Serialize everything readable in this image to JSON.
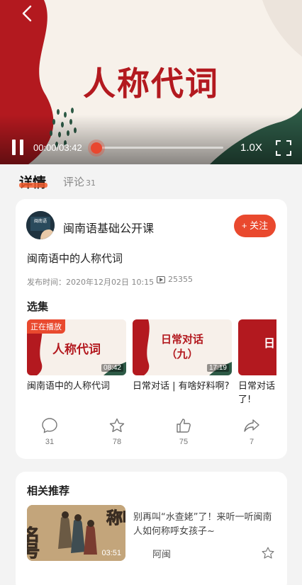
{
  "player": {
    "title": "人称代词",
    "current_time": "00:00",
    "separator": "/",
    "duration": "03:42",
    "speed": "1.0X",
    "progress": 0.0
  },
  "tabs": {
    "detail_label": "详情",
    "comment_label": "评论",
    "comment_count": "31"
  },
  "channel": {
    "avatar_text": "闽南语",
    "name": "闽南语基础公开课",
    "follow_label": "+ 关注"
  },
  "video": {
    "title": "闽南语中的人称代词",
    "publish_time": "发布时间：2020年12月02日 10:15",
    "play_count": "25355"
  },
  "episodes_section": {
    "label": "选集",
    "items": [
      {
        "thumb_text": "人称代词",
        "badge": "正在播放",
        "duration": "08:42",
        "name": "闽南语中的人称代词"
      },
      {
        "thumb_text_1": "日常对话",
        "thumb_text_2": "（九）",
        "duration": "17:19",
        "name": "日常对话 | 有啥好料啊?"
      },
      {
        "thumb_text": "日",
        "name": "日常对话了!"
      }
    ]
  },
  "actions": {
    "comment_count": "31",
    "favorite_count": "78",
    "like_count": "75",
    "share_count": "7"
  },
  "recommend": {
    "label": "相关推荐",
    "thumb_text_left": "名号",
    "thumb_text_right": "称呼",
    "duration": "03:51",
    "title": "别再叫“水查姥”了！来听一听闽南人如何称呼女孩子~",
    "source": "阿闽"
  },
  "colors": {
    "accent": "#e9492e",
    "brand_red": "#b3191f",
    "brand_green": "#2d5a46"
  }
}
